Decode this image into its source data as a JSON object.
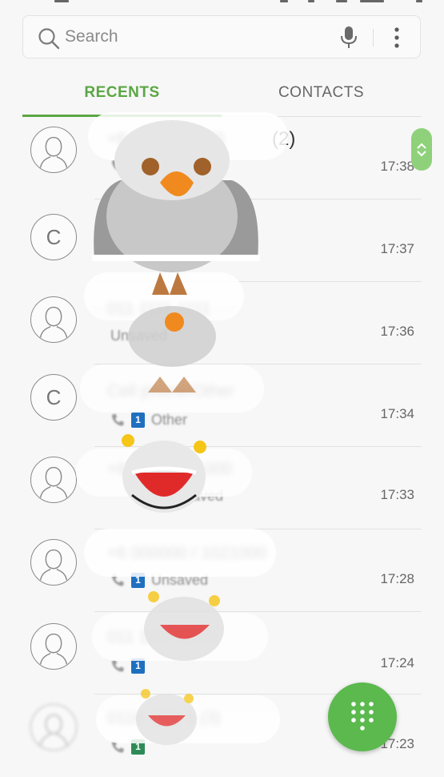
{
  "search": {
    "placeholder": "Search"
  },
  "tabs": [
    {
      "label": "RECENTS",
      "active": true
    },
    {
      "label": "CONTACTS",
      "active": false
    }
  ],
  "accent_color": "#5aa744",
  "recents": [
    {
      "avatar": "person-icon",
      "letter": "",
      "name": "+6 1000 1 1000",
      "count": "(2)",
      "label": "",
      "sim_color": "#1f6fbf",
      "time": "17:38"
    },
    {
      "avatar": "letter",
      "letter": "C",
      "name": "",
      "count": "",
      "label": "",
      "sim_color": "#1f6fbf",
      "time": "17:37"
    },
    {
      "avatar": "person-icon",
      "letter": "",
      "name": "011 1111 1111",
      "count": "",
      "label": "Unsaved",
      "sim_color": "#1f6fbf",
      "time": "17:36"
    },
    {
      "avatar": "letter",
      "letter": "C",
      "name": "Cell phone/Other",
      "count": "",
      "label": "Other",
      "sim_color": "#1f6fbf",
      "time": "17:34"
    },
    {
      "avatar": "person-icon",
      "letter": "",
      "name": "+6 1000 11 1000",
      "count": "",
      "label": "Unsaved",
      "sim_color": "#1f6fbf",
      "time": "17:33"
    },
    {
      "avatar": "person-icon",
      "letter": "",
      "name": "+6 000000 / 1021000",
      "count": "",
      "label": "Unsaved",
      "sim_color": "#1f6fbf",
      "time": "17:28"
    },
    {
      "avatar": "person-icon",
      "letter": "",
      "name": "011 1111 11111",
      "count": "",
      "label": "Unsaved",
      "sim_color": "#1f6fbf",
      "time": "17:24"
    },
    {
      "avatar": "person-icon",
      "letter": "",
      "name": "0116 1111 1 (3)",
      "count": "",
      "label": "Unsaved",
      "sim_color": "#2e8b57",
      "time": "17:23"
    }
  ],
  "fab": {
    "icon": "dialpad-icon",
    "color": "#5bb94e"
  }
}
